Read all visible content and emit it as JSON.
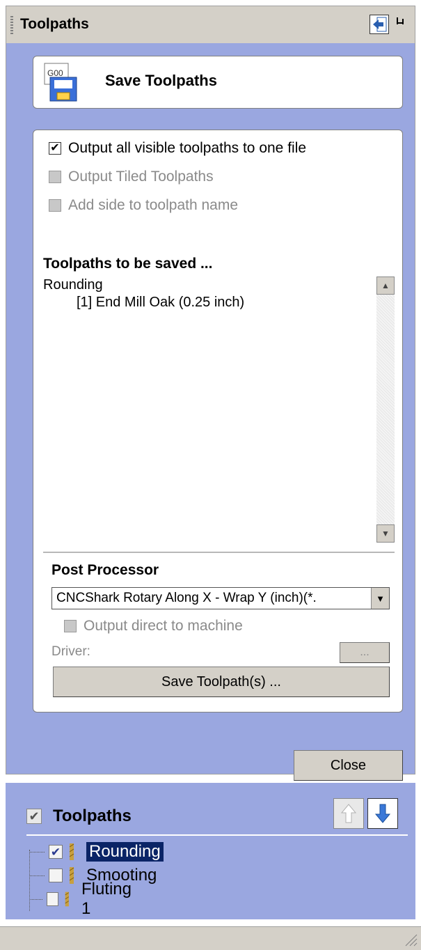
{
  "panel": {
    "title": "Toolpaths",
    "save_card_title": "Save Toolpaths",
    "icon_text": "G00"
  },
  "options": {
    "output_all_visible": {
      "label": "Output all visible toolpaths to one file",
      "checked": true
    },
    "output_tiled": {
      "label": "Output Tiled Toolpaths",
      "checked": false,
      "disabled": true
    },
    "add_side": {
      "label": "Add side to toolpath name",
      "checked": false,
      "disabled": true
    }
  },
  "toolpaths_to_save": {
    "heading": "Toolpaths to be saved ...",
    "items": [
      {
        "label": "Rounding"
      },
      {
        "label": "[1] End Mill Oak (0.25 inch)"
      }
    ]
  },
  "post_processor": {
    "heading": "Post Processor",
    "selected": "CNCShark Rotary Along X - Wrap Y (inch)(*.",
    "output_direct_label": "Output direct to machine",
    "driver_label": "Driver:",
    "driver_button": "...",
    "save_button": "Save Toolpath(s) ..."
  },
  "close_button": "Close",
  "tree": {
    "heading": "Toolpaths",
    "items": [
      {
        "label": "Rounding",
        "checked": true,
        "selected": true
      },
      {
        "label": "Smooting",
        "checked": false,
        "selected": false
      },
      {
        "label": "Fluting 1",
        "checked": false,
        "selected": false
      }
    ]
  },
  "colors": {
    "panel_blue": "#9aa7e0",
    "selection": "#0a2466",
    "control_gray": "#d4d0c8"
  }
}
